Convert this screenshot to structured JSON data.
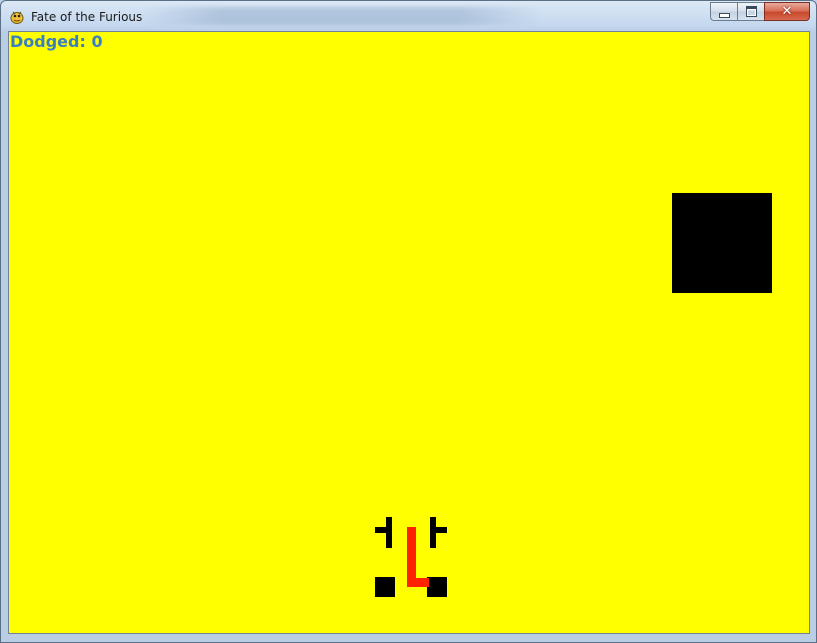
{
  "window": {
    "title": "Fate of the Furious",
    "app_icon": "pygame-snake-icon",
    "controls": {
      "minimize_icon": "minimize-icon",
      "maximize_icon": "maximize-icon",
      "close_icon": "close-icon",
      "close_glyph": "✕"
    }
  },
  "game": {
    "background_color": "#ffff00",
    "score_label": "Dodged: 0",
    "score_color": "#3a7fc1",
    "obstacle": {
      "color": "#000000"
    },
    "player_car": {
      "body_color": "#ff2200",
      "wheel_color": "#000000"
    }
  }
}
